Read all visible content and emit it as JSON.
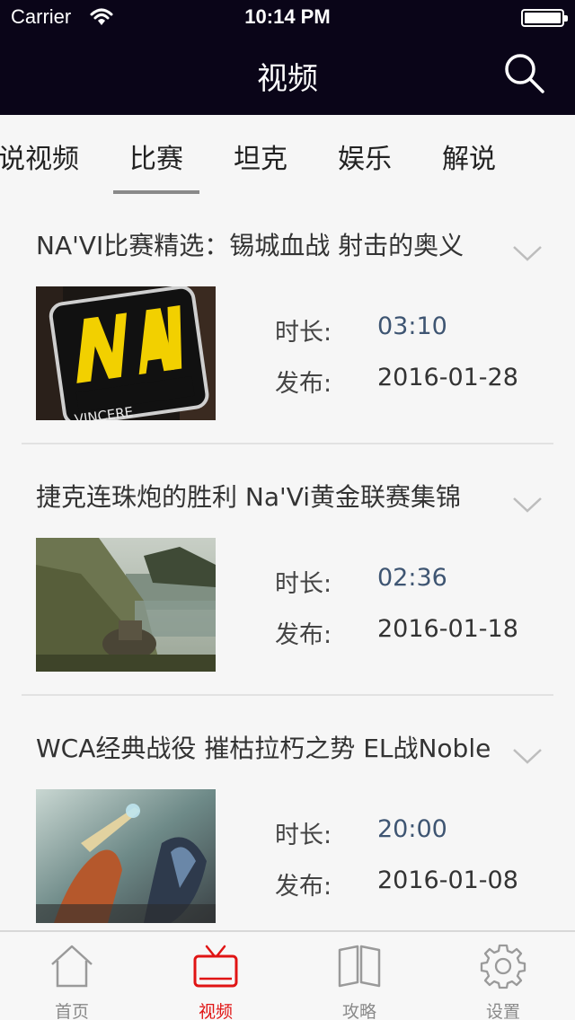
{
  "status_bar": {
    "carrier": "Carrier",
    "time": "10:14 PM",
    "battery_level": 1.0
  },
  "nav": {
    "title": "视频",
    "search_icon": "search-icon"
  },
  "category_tabs": [
    {
      "label": "说视频",
      "active": false
    },
    {
      "label": "比赛",
      "active": true
    },
    {
      "label": "坦克",
      "active": false
    },
    {
      "label": "娱乐",
      "active": false
    },
    {
      "label": "解说",
      "active": false
    }
  ],
  "videos": [
    {
      "title": "NA'VI比赛精选：锡城血战 射击的奥义",
      "duration_label": "时长:",
      "duration": "03:10",
      "published_label": "发布:",
      "published": "2016-01-28",
      "thumb_logo_text": "NAVI",
      "thumb_tagline": "VINCERE"
    },
    {
      "title": "捷克连珠炮的胜利 Na'Vi黄金联赛集锦",
      "duration_label": "时长:",
      "duration": "02:36",
      "published_label": "发布:",
      "published": "2016-01-18"
    },
    {
      "title": "WCA经典战役 摧枯拉朽之势 EL战Noble",
      "duration_label": "时长:",
      "duration": "20:00",
      "published_label": "发布:",
      "published": "2016-01-08"
    }
  ],
  "tab_bar": [
    {
      "label": "首页",
      "icon": "home-icon",
      "active": false
    },
    {
      "label": "视频",
      "icon": "tv-icon",
      "active": true
    },
    {
      "label": "攻略",
      "icon": "book-icon",
      "active": false
    },
    {
      "label": "设置",
      "icon": "gear-icon",
      "active": false
    }
  ],
  "colors": {
    "nav_background": "#0a0518",
    "accent_red": "#e01414",
    "duration_text": "#3e5572",
    "tab_inactive": "#8a8a8a"
  }
}
